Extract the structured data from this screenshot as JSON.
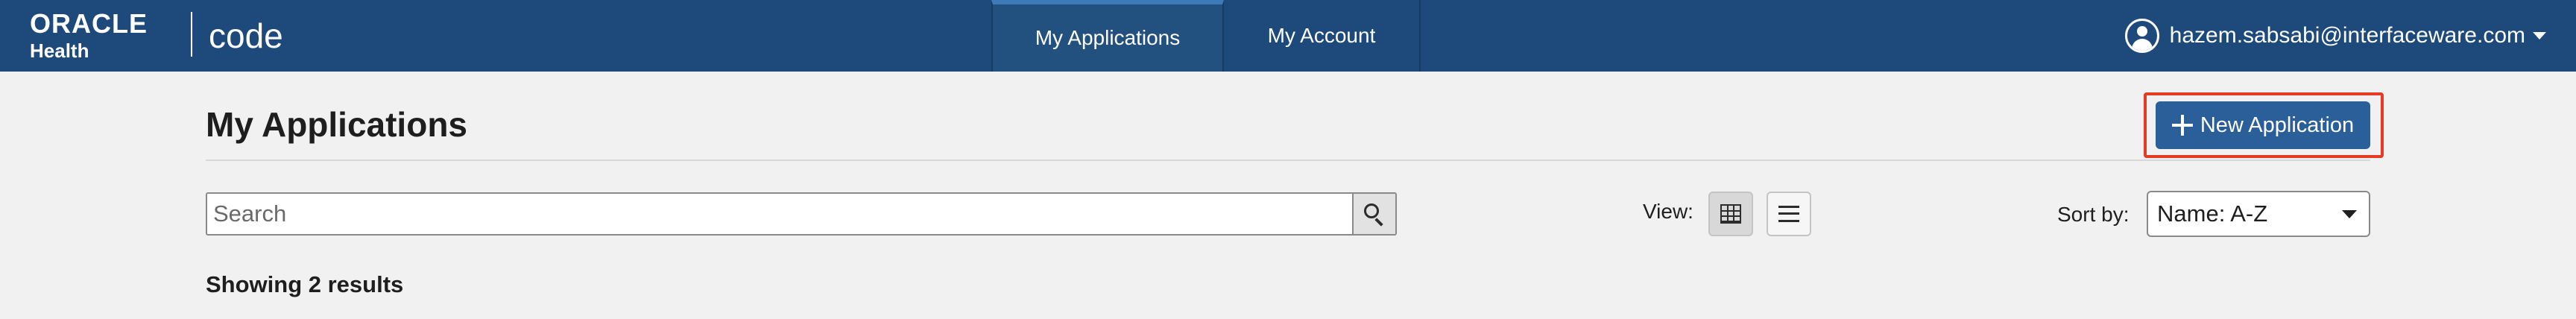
{
  "header": {
    "brand": {
      "oracle": "ORACLE",
      "health": "Health",
      "product": "code"
    },
    "nav": [
      {
        "label": "My Applications",
        "active": true
      },
      {
        "label": "My Account",
        "active": false
      }
    ],
    "user": {
      "email": "hazem.sabsabi@interfaceware.com",
      "icon": "user-circle-icon"
    }
  },
  "main": {
    "title": "My Applications",
    "new_application_label": "New Application",
    "search": {
      "placeholder": "Search",
      "value": ""
    },
    "view": {
      "label": "View:",
      "selected": "grid"
    },
    "sort": {
      "label": "Sort by:",
      "selected": "Name: A-Z"
    },
    "results_text": "Showing 2 results"
  },
  "colors": {
    "header_bg": "#1d4a7a",
    "primary_button": "#2b5f9a",
    "highlight_border": "#e43b25",
    "page_bg": "#f1f1f1"
  }
}
